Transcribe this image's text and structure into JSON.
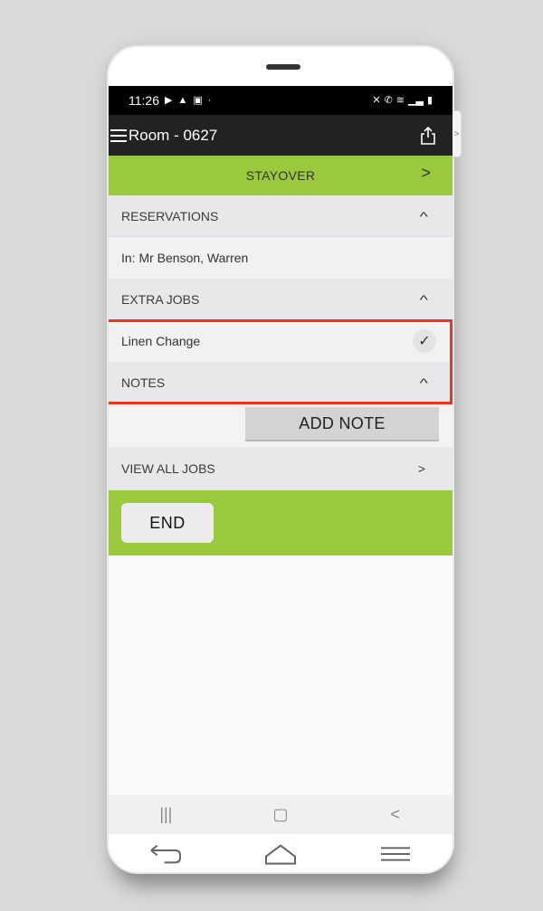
{
  "status_bar": {
    "time": "11:26",
    "left_icons": [
      "youtube-icon",
      "drive-icon",
      "gallery-icon",
      "dot-icon"
    ],
    "right_icons": [
      "mute-icon",
      "wifi-call-icon",
      "wifi-icon",
      "signal-icon",
      "battery-icon"
    ]
  },
  "app_bar": {
    "title": "Room - 0627",
    "menu_icon": "hamburger-icon",
    "action_icon": "share-icon"
  },
  "status_banner": {
    "label": "STAYOVER",
    "chevron": ">"
  },
  "sections": {
    "reservations": {
      "header": "RESERVATIONS",
      "chevron": "^",
      "row": "In: Mr Benson, Warren"
    },
    "extra_jobs": {
      "header": "EXTRA JOBS",
      "chevron": "^",
      "row": "Linen Change",
      "row_icon": "checkmark-icon",
      "check_glyph": "✓"
    },
    "notes": {
      "header": "NOTES",
      "chevron": "^",
      "add_note_label": "ADD NOTE"
    },
    "view_all_jobs": {
      "label": "VIEW ALL JOBS",
      "chevron": ">"
    }
  },
  "end_button": {
    "label": "END"
  },
  "side_tab": {
    "glyph": ">"
  },
  "system_nav": {
    "recents": "|||",
    "home": "▢",
    "back": "<"
  },
  "highlight": {
    "target": "extra_jobs",
    "color": "#f0351f"
  },
  "colors": {
    "accent_green": "#9bc93d",
    "app_bar": "#222222",
    "status_bar": "#000000"
  }
}
